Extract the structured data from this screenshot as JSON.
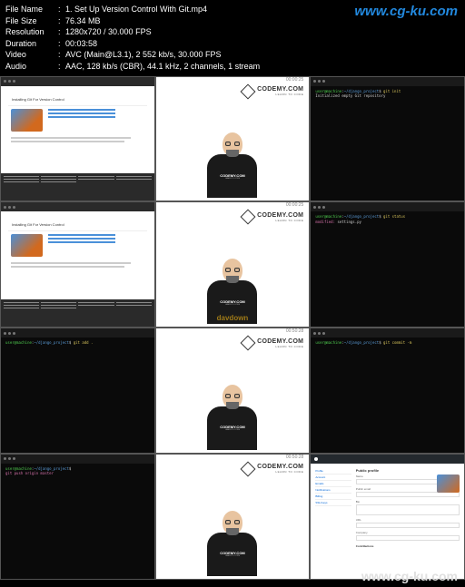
{
  "watermarks": {
    "top": "www.cg-ku.com",
    "bottom": "www.cg-ku.com",
    "center": "davdown"
  },
  "header": {
    "fileName": {
      "label": "File Name",
      "value": "1. Set Up Version Control With Git.mp4"
    },
    "fileSize": {
      "label": "File Size",
      "value": "76.34 MB"
    },
    "resolution": {
      "label": "Resolution",
      "value": "1280x720 / 30.000 FPS"
    },
    "duration": {
      "label": "Duration",
      "value": "00:03:58"
    },
    "video": {
      "label": "Video",
      "value": "AVC (Main@L3.1), 2 552 kb/s, 30.000 FPS"
    },
    "audio": {
      "label": "Audio",
      "value": "AAC, 128 kb/s (CBR), 44.1 kHz, 2 channels, 1 stream"
    }
  },
  "codemy": {
    "brand": "CODEMY.COM",
    "tagline": "LEARN TO CODE",
    "timestamps": [
      "00:00:25",
      "00:00:25",
      "00:50:28",
      "00:50:28",
      "00:50:28",
      "00:50:28",
      "00:50:28"
    ]
  },
  "browser_page": {
    "title": "Installing Git For Version Control"
  },
  "github": {
    "section": "Public profile",
    "contributions": "Contributions",
    "menu": [
      "Profile",
      "Account",
      "Emails",
      "Notifications",
      "Billing",
      "SSH keys"
    ],
    "fields": [
      "Name",
      "Public email",
      "Bio",
      "URL",
      "Company",
      "Location"
    ]
  },
  "terminal": {
    "prompt": "user@machine",
    "path": "~/django_project",
    "lines": [
      "git init",
      "git status",
      "git add .",
      "git commit -m"
    ]
  }
}
